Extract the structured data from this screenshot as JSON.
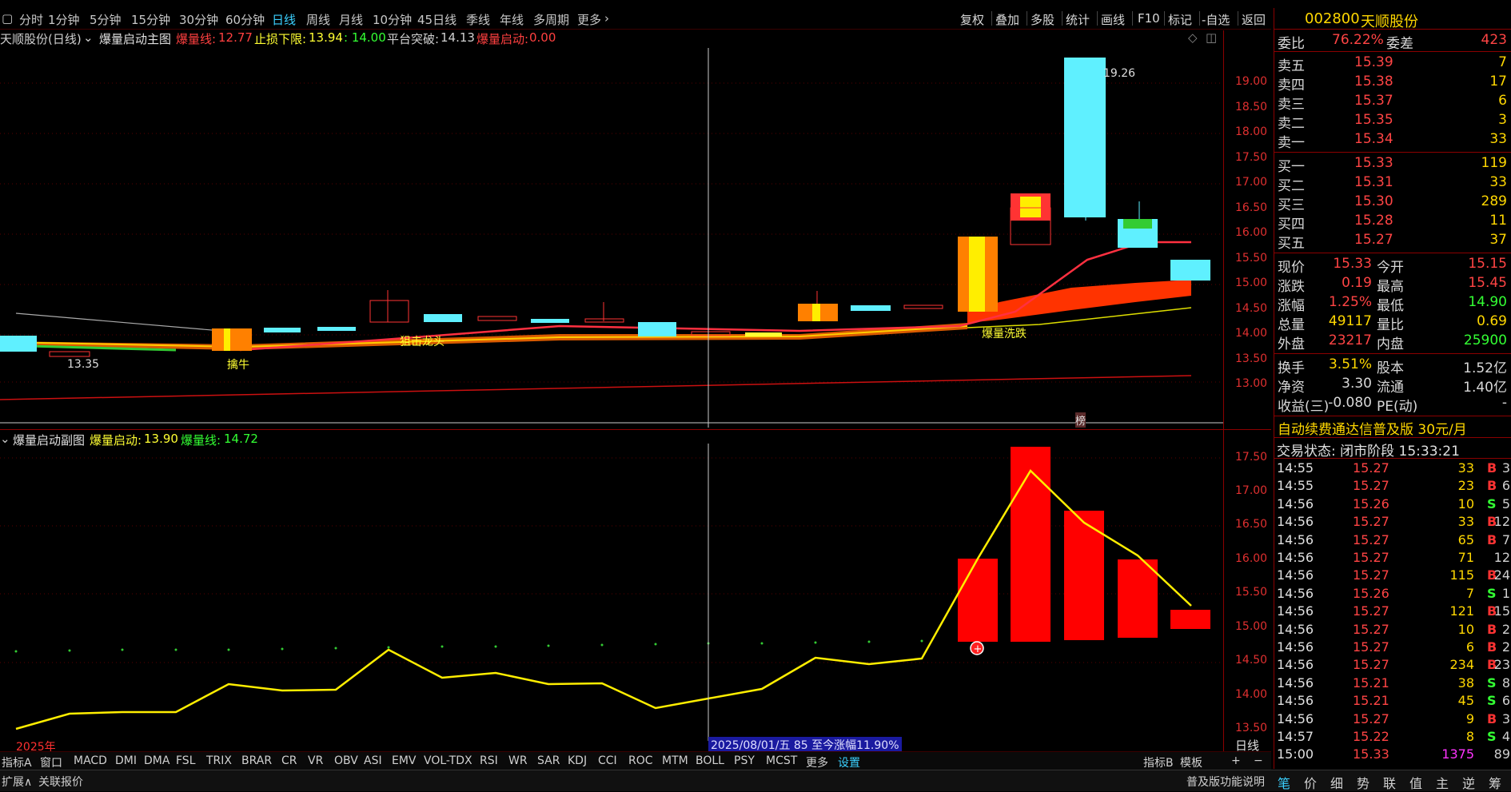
{
  "periods": [
    "分时",
    "1分钟",
    "5分钟",
    "15分钟",
    "30分钟",
    "60分钟",
    "日线",
    "周线",
    "月线",
    "10分钟",
    "45日线",
    "季线",
    "年线",
    "多周期",
    "更多"
  ],
  "active_period": "日线",
  "tools": [
    "复权",
    "叠加",
    "多股",
    "统计",
    "画线",
    "F10",
    "标记",
    "-自选",
    "返回"
  ],
  "main_title": {
    "stock": "天顺股份(日线)",
    "indicator": "爆量启动主图",
    "baoliang_label": "爆量线:",
    "baoliang_val": "12.77",
    "zhisun_label": "止损下限:",
    "zhisun_val1": "13.94",
    "zhisun_val2": ": 14.00",
    "pingtai_label": "平台突破:",
    "pingtai_val": "14.13",
    "qidong_label": "爆量启动:",
    "qidong_val": "0.00"
  },
  "price_axis": [
    "19.00",
    "18.50",
    "18.00",
    "17.50",
    "17.00",
    "16.50",
    "16.00",
    "15.50",
    "15.00",
    "14.50",
    "14.00",
    "13.50",
    "13.00"
  ],
  "annotations": {
    "high": "19.26",
    "low": "13.35",
    "qiniu": "擒牛",
    "jiji": "狙击龙头",
    "huandie": "爆量洗跌",
    "bang": "榜"
  },
  "sub_title": {
    "name": "爆量启动副图",
    "qidong_label": "爆量启动:",
    "qidong_val": "13.90",
    "xian_label": "爆量线:",
    "xian_val": "14.72"
  },
  "sub_axis": [
    "17.50",
    "17.00",
    "16.50",
    "16.00",
    "15.50",
    "15.00",
    "14.50",
    "14.00",
    "13.50"
  ],
  "year_label": "2025年",
  "date_info": "2025/08/01/五 85 至今涨幅11.90%",
  "axis_mode": "日线",
  "tabs": [
    "指标A",
    "窗口",
    "MACD",
    "DMI",
    "DMA",
    "FSL",
    "TRIX",
    "BRAR",
    "CR",
    "VR",
    "OBV",
    "ASI",
    "EMV",
    "VOL-TDX",
    "RSI",
    "WR",
    "SAR",
    "KDJ",
    "CCI",
    "ROC",
    "MTM",
    "BOLL",
    "PSY",
    "MCST",
    "更多",
    "设置"
  ],
  "tabs_right": [
    "指标B",
    "模板",
    "+",
    "−"
  ],
  "ext": {
    "left1": "扩展∧",
    "left2": "关联报价",
    "right": "普及版功能说明"
  },
  "right_panel": {
    "code": "002800",
    "name": "天顺股份",
    "weibi_label": "委比",
    "weibi": "76.22%",
    "weicha_label": "委差",
    "weicha": "423",
    "sells": [
      {
        "label": "卖五",
        "price": "15.39",
        "vol": "7"
      },
      {
        "label": "卖四",
        "price": "15.38",
        "vol": "17"
      },
      {
        "label": "卖三",
        "price": "15.37",
        "vol": "6"
      },
      {
        "label": "卖二",
        "price": "15.35",
        "vol": "3"
      },
      {
        "label": "卖一",
        "price": "15.34",
        "vol": "33"
      }
    ],
    "buys": [
      {
        "label": "买一",
        "price": "15.33",
        "vol": "119"
      },
      {
        "label": "买二",
        "price": "15.31",
        "vol": "33"
      },
      {
        "label": "买三",
        "price": "15.30",
        "vol": "289"
      },
      {
        "label": "买四",
        "price": "15.28",
        "vol": "11"
      },
      {
        "label": "买五",
        "price": "15.27",
        "vol": "37"
      }
    ],
    "stats": [
      {
        "l1": "现价",
        "v1": "15.33",
        "l2": "今开",
        "v2": "15.15"
      },
      {
        "l1": "涨跌",
        "v1": "0.19",
        "l2": "最高",
        "v2": "15.45"
      },
      {
        "l1": "涨幅",
        "v1": "1.25%",
        "l2": "最低",
        "v2": "14.90"
      },
      {
        "l1": "总量",
        "v1": "49117",
        "l2": "量比",
        "v2": "0.69"
      },
      {
        "l1": "外盘",
        "v1": "23217",
        "l2": "内盘",
        "v2": "25900"
      }
    ],
    "stats2": [
      {
        "l1": "换手",
        "v1": "3.51%",
        "l2": "股本",
        "v2": "1.52亿"
      },
      {
        "l1": "净资",
        "v1": "3.30",
        "l2": "流通",
        "v2": "1.40亿"
      },
      {
        "l1": "收益(三)",
        "v1": "-0.080",
        "l2": "PE(动)",
        "v2": "-"
      }
    ],
    "promo": "自动续费通达信普及版  30元/月",
    "trade_status": "交易状态: 闭市阶段 15:33:21",
    "ticks": [
      {
        "t": "14:55",
        "p": "15.27",
        "v": "33",
        "bs": "B",
        "n": "3"
      },
      {
        "t": "14:55",
        "p": "15.27",
        "v": "23",
        "bs": "B",
        "n": "6"
      },
      {
        "t": "14:56",
        "p": "15.26",
        "v": "10",
        "bs": "S",
        "n": "5"
      },
      {
        "t": "14:56",
        "p": "15.27",
        "v": "33",
        "bs": "B",
        "n": "12"
      },
      {
        "t": "14:56",
        "p": "15.27",
        "v": "65",
        "bs": "B",
        "n": "7"
      },
      {
        "t": "14:56",
        "p": "15.27",
        "v": "71",
        "bs": "",
        "n": "12"
      },
      {
        "t": "14:56",
        "p": "15.27",
        "v": "115",
        "bs": "B",
        "n": "24"
      },
      {
        "t": "14:56",
        "p": "15.26",
        "v": "7",
        "bs": "S",
        "n": "1"
      },
      {
        "t": "14:56",
        "p": "15.27",
        "v": "121",
        "bs": "B",
        "n": "15"
      },
      {
        "t": "14:56",
        "p": "15.27",
        "v": "10",
        "bs": "B",
        "n": "2"
      },
      {
        "t": "14:56",
        "p": "15.27",
        "v": "6",
        "bs": "B",
        "n": "2"
      },
      {
        "t": "14:56",
        "p": "15.27",
        "v": "234",
        "bs": "B",
        "n": "23"
      },
      {
        "t": "14:56",
        "p": "15.21",
        "v": "38",
        "bs": "S",
        "n": "8"
      },
      {
        "t": "14:56",
        "p": "15.21",
        "v": "45",
        "bs": "S",
        "n": "6"
      },
      {
        "t": "14:56",
        "p": "15.27",
        "v": "9",
        "bs": "B",
        "n": "3"
      },
      {
        "t": "14:57",
        "p": "15.22",
        "v": "8",
        "bs": "S",
        "n": "4"
      },
      {
        "t": "15:00",
        "p": "15.33",
        "v": "1375",
        "bs": "",
        "n": "89"
      }
    ],
    "bottom_tabs": [
      "笔",
      "价",
      "细",
      "势",
      "联",
      "值",
      "主",
      "逆",
      "筹"
    ]
  },
  "colors": {
    "up": "#ff3333",
    "down": "#5ff0ff",
    "yellow": "#ffff33",
    "axis": "#e03030",
    "accent": "#3bd0ff"
  }
}
